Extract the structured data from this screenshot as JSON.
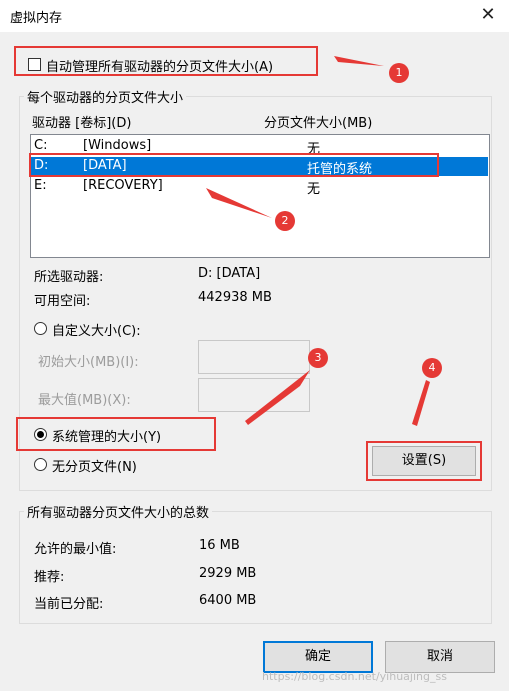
{
  "window": {
    "title": "虚拟内存",
    "close_glyph": "✕"
  },
  "auto_manage": {
    "label": "自动管理所有驱动器的分页文件大小(A)",
    "checked": false
  },
  "drives_group": {
    "title": "每个驱动器的分页文件大小",
    "col_drive": "驱动器 [卷标](D)",
    "col_size": "分页文件大小(MB)",
    "rows": [
      {
        "letter": "C:",
        "label": "[Windows]",
        "size": "无",
        "selected": false
      },
      {
        "letter": "D:",
        "label": "[DATA]",
        "size": "托管的系统",
        "selected": true
      },
      {
        "letter": "E:",
        "label": "[RECOVERY]",
        "size": "无",
        "selected": false
      }
    ],
    "selected_drive_label": "所选驱动器:",
    "selected_drive_value": "D:  [DATA]",
    "free_space_label": "可用空间:",
    "free_space_value": "442938 MB",
    "custom_size_label": "自定义大小(C):",
    "initial_size_label": "初始大小(MB)(I):",
    "max_size_label": "最大值(MB)(X):",
    "system_managed_label": "系统管理的大小(Y)",
    "no_paging_label": "无分页文件(N)",
    "selected_option": "system_managed",
    "set_button": "设置(S)"
  },
  "totals_group": {
    "title": "所有驱动器分页文件大小的总数",
    "min_label": "允许的最小值:",
    "min_value": "16 MB",
    "recommended_label": "推荐:",
    "recommended_value": "2929 MB",
    "current_label": "当前已分配:",
    "current_value": "6400 MB"
  },
  "buttons": {
    "ok": "确定",
    "cancel": "取消"
  },
  "annotations": {
    "badge1": "1",
    "badge2": "2",
    "badge3": "3",
    "badge4": "4",
    "color": "#e53935"
  },
  "watermark": "https://blog.csdn.net/yihuajing_ss"
}
